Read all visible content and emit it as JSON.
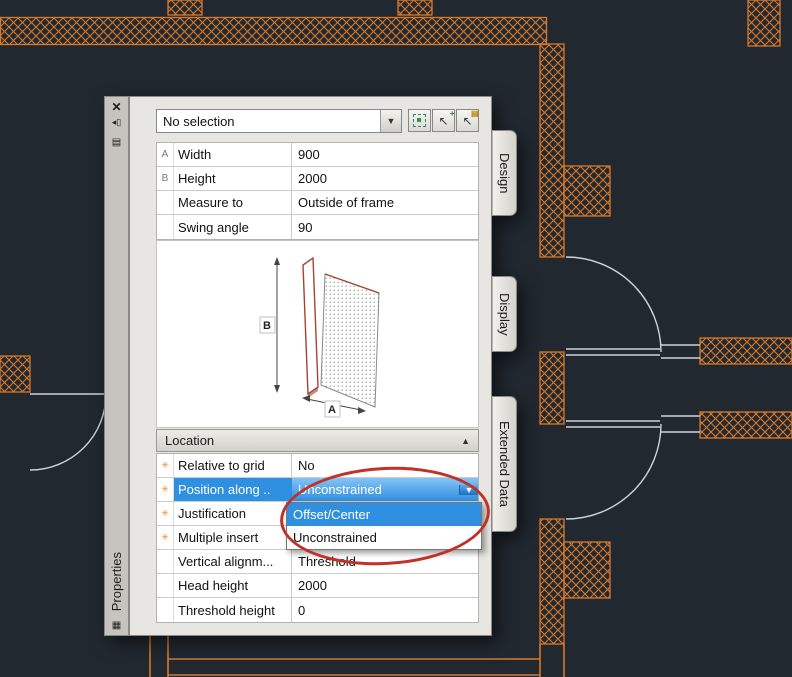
{
  "colors": {
    "canvas_bg": "#212830",
    "wall_orange": "#d8792b",
    "line_light": "#cdd3db",
    "selection_blue": "#2f8fe0",
    "annotation_red": "#c23128",
    "star_orange": "#e8862c"
  },
  "palette": {
    "title": "Properties",
    "dropdown_arrow": "▼",
    "titlebar_icons": [
      {
        "name": "close-icon",
        "glyph": "✕"
      },
      {
        "name": "autohide-icon",
        "glyph": "◂▯"
      },
      {
        "name": "menu-icon",
        "glyph": "▤"
      },
      {
        "name": "bottom-icon",
        "glyph": "▦"
      }
    ],
    "selection_dropdown": {
      "value": "No selection"
    },
    "toolbar_buttons": [
      {
        "name": "toggle-pickadd"
      },
      {
        "name": "select-objects",
        "glyph": "↖",
        "badge": "+"
      },
      {
        "name": "quick-select",
        "glyph": "↖",
        "badge": "▤"
      }
    ],
    "tabs": [
      {
        "label": "Design"
      },
      {
        "label": "Display"
      },
      {
        "label": "Extended Data"
      }
    ],
    "design_rows": [
      {
        "key": "A",
        "label": "Width",
        "value": "900"
      },
      {
        "key": "B",
        "label": "Height",
        "value": "2000"
      },
      {
        "key": "",
        "label": "Measure to",
        "value": "Outside of frame"
      },
      {
        "key": "",
        "label": "Swing angle",
        "value": "90"
      }
    ],
    "door_image_labels": {
      "a": "A",
      "b": "B"
    },
    "location": {
      "header": "Location",
      "collapse_icon": "▲",
      "rows": [
        {
          "star": "✳",
          "label": "Relative to grid",
          "value": "No"
        },
        {
          "star": "✳",
          "label": "Position along ..",
          "value": "Unconstrained"
        },
        {
          "star": "✳",
          "label": "Justification",
          "value": ""
        },
        {
          "star": "✳",
          "label": "Multiple insert",
          "value": ""
        },
        {
          "star": "",
          "label": "Vertical alignm...",
          "value": "Threshold"
        },
        {
          "star": "",
          "label": "Head height",
          "value": "2000"
        },
        {
          "star": "",
          "label": "Threshold height",
          "value": "0"
        }
      ],
      "open_dropdown": {
        "items": [
          {
            "label": "Offset/Center",
            "selected": true
          },
          {
            "label": "Unconstrained",
            "selected": false
          }
        ]
      }
    }
  }
}
